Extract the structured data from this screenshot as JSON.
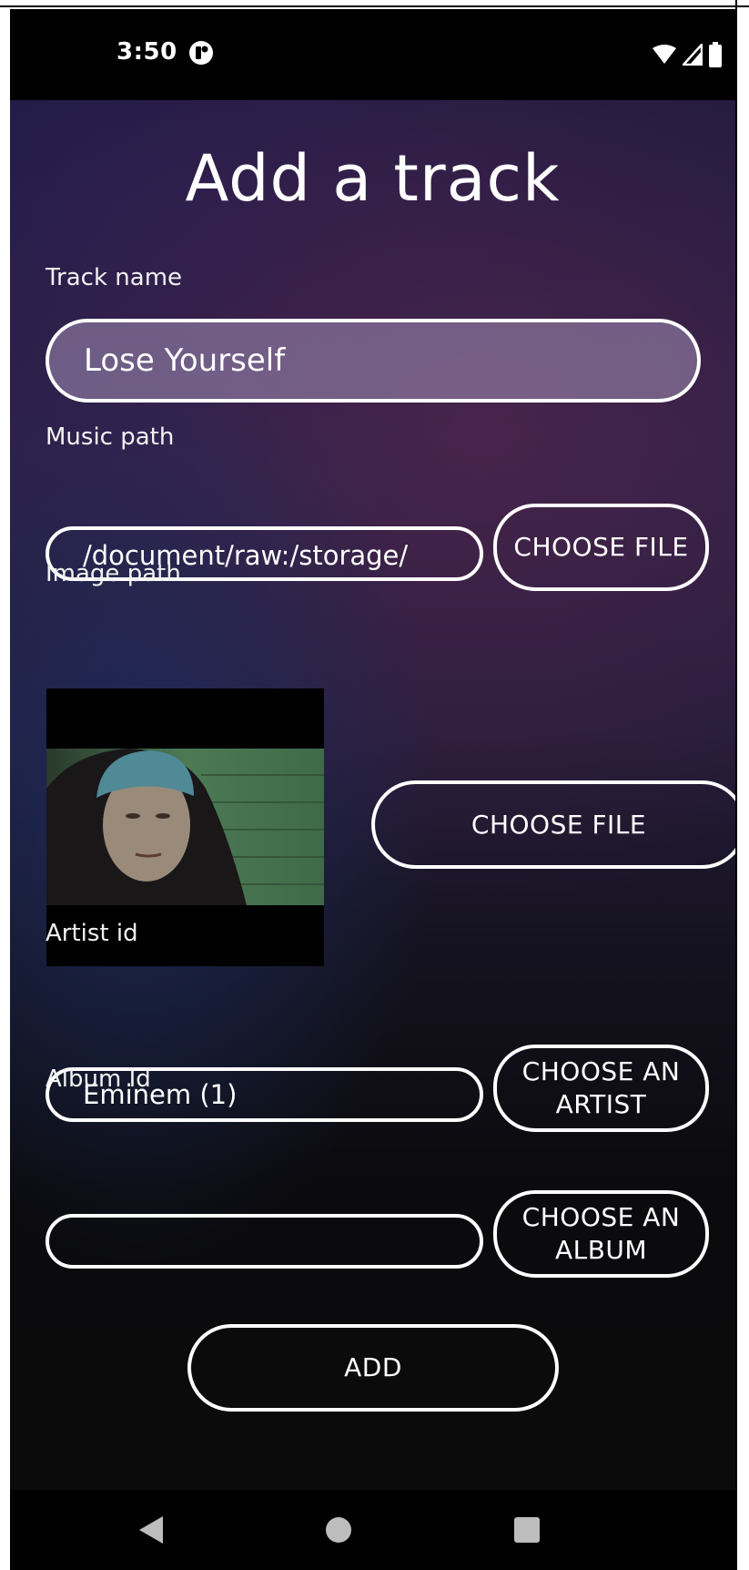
{
  "status_bar": {
    "time": "3:50",
    "app_icon": "app-notification-icon",
    "icons": [
      "wifi-icon",
      "signal-icon",
      "battery-icon"
    ]
  },
  "page": {
    "title": "Add a track"
  },
  "form": {
    "track_name": {
      "label": "Track name",
      "value": "Lose Yourself"
    },
    "music_path": {
      "label": "Music path",
      "value": "/document/raw:/storage/",
      "button_label": "CHOOSE FILE"
    },
    "image_path": {
      "label": "Image path",
      "button_label": "CHOOSE FILE"
    },
    "artist_id": {
      "label": "Artist id",
      "value": "Eminem (1)",
      "button_line1": "CHOOSE AN",
      "button_line2": "ARTIST"
    },
    "album_id": {
      "label": "Album Id",
      "value": "",
      "button_line1": "CHOOSE AN",
      "button_line2": "ALBUM"
    },
    "add_button_label": "ADD"
  },
  "nav_bar": {
    "icons": [
      "back-icon",
      "home-icon",
      "recents-icon"
    ]
  },
  "colors": {
    "field_fill": "#8f80a8",
    "outline": "#ffffff",
    "background_bottom": "#0b0b0b"
  }
}
